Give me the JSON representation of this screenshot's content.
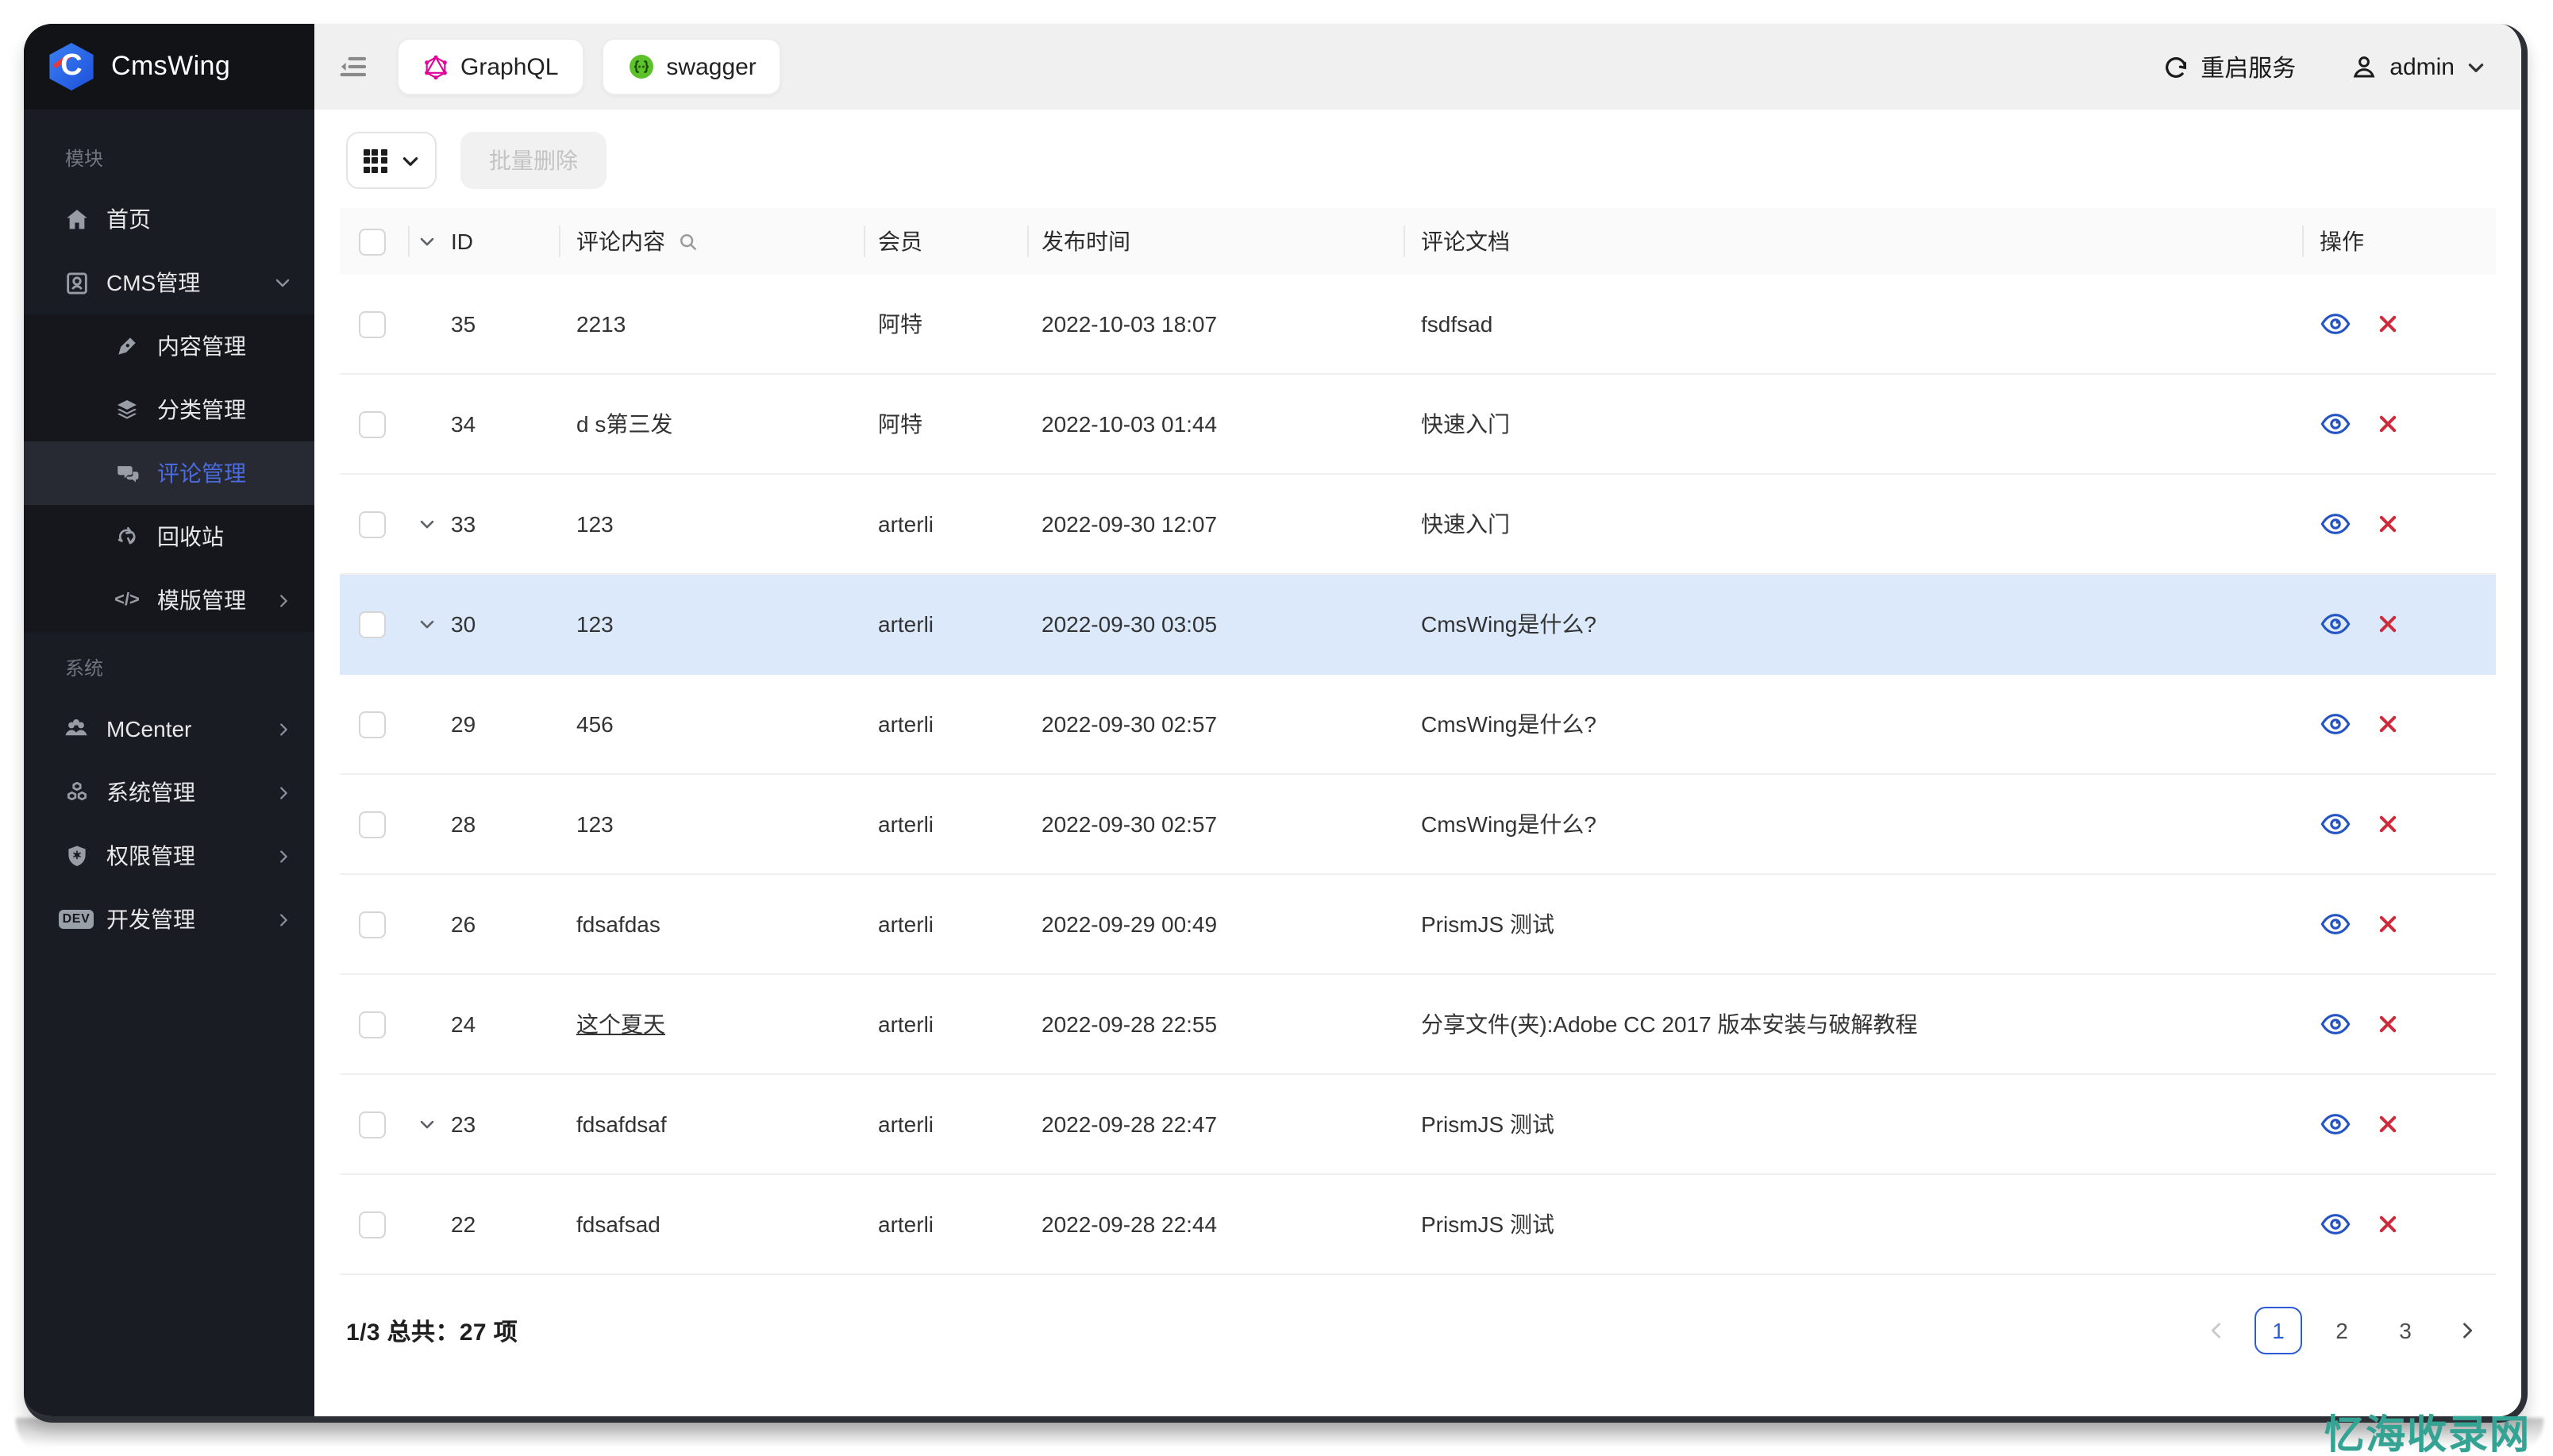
{
  "app": {
    "title": "CmsWing"
  },
  "sidebar": {
    "logo_text": "CmsWing",
    "dev_badge": "DEV",
    "sections": [
      {
        "label": "模块",
        "items": [
          {
            "label": "首页",
            "icon": "home-icon"
          },
          {
            "label": "CMS管理",
            "icon": "cms-book-icon",
            "chevron": "down"
          }
        ],
        "children": [
          {
            "label": "内容管理",
            "icon": "pen-icon"
          },
          {
            "label": "分类管理",
            "icon": "layers-icon"
          },
          {
            "label": "评论管理",
            "icon": "comments-icon",
            "active": true
          },
          {
            "label": "回收站",
            "icon": "recycle-icon"
          },
          {
            "label": "模版管理",
            "icon": "code-icon",
            "chevron": "right"
          }
        ]
      },
      {
        "label": "系统",
        "items": [
          {
            "label": "MCenter",
            "icon": "users-icon",
            "chevron": "right"
          },
          {
            "label": "系统管理",
            "icon": "cubes-icon",
            "chevron": "right"
          },
          {
            "label": "权限管理",
            "icon": "shield-icon",
            "chevron": "right"
          },
          {
            "label": "开发管理",
            "icon": "dev-icon",
            "chevron": "right"
          }
        ]
      }
    ]
  },
  "topbar": {
    "graphql_label": "GraphQL",
    "swagger_label": "swagger",
    "restart_label": "重启服务",
    "user_label": "admin"
  },
  "toolbar": {
    "batch_delete_label": "批量删除"
  },
  "table": {
    "headers": {
      "id": "ID",
      "content": "评论内容",
      "member": "会员",
      "time": "发布时间",
      "doc": "评论文档",
      "actions": "操作"
    },
    "rows": [
      {
        "id": "35",
        "content": "2213",
        "member": "阿特",
        "time": "2022-10-03 18:07",
        "doc": "fsdfsad",
        "expander": false,
        "highlight": false,
        "link": false
      },
      {
        "id": "34",
        "content": "d s第三发",
        "member": "阿特",
        "time": "2022-10-03 01:44",
        "doc": "快速入门",
        "expander": false,
        "highlight": false,
        "link": false
      },
      {
        "id": "33",
        "content": "123",
        "member": "arterli",
        "time": "2022-09-30 12:07",
        "doc": "快速入门",
        "expander": true,
        "highlight": false,
        "link": false
      },
      {
        "id": "30",
        "content": "123",
        "member": "arterli",
        "time": "2022-09-30 03:05",
        "doc": "CmsWing是什么?",
        "expander": true,
        "highlight": true,
        "link": false
      },
      {
        "id": "29",
        "content": "456",
        "member": "arterli",
        "time": "2022-09-30 02:57",
        "doc": "CmsWing是什么?",
        "expander": false,
        "highlight": false,
        "link": false
      },
      {
        "id": "28",
        "content": "123",
        "member": "arterli",
        "time": "2022-09-30 02:57",
        "doc": "CmsWing是什么?",
        "expander": false,
        "highlight": false,
        "link": false
      },
      {
        "id": "26",
        "content": "fdsafdas",
        "member": "arterli",
        "time": "2022-09-29 00:49",
        "doc": "PrismJS 测试",
        "expander": false,
        "highlight": false,
        "link": false
      },
      {
        "id": "24",
        "content": "这个夏天",
        "member": "arterli",
        "time": "2022-09-28 22:55",
        "doc": "分享文件(夹):Adobe CC 2017 版本安装与破解教程",
        "expander": false,
        "highlight": false,
        "link": true
      },
      {
        "id": "23",
        "content": "fdsafdsaf",
        "member": "arterli",
        "time": "2022-09-28 22:47",
        "doc": "PrismJS 测试",
        "expander": true,
        "highlight": false,
        "link": false
      },
      {
        "id": "22",
        "content": "fdsafsad",
        "member": "arterli",
        "time": "2022-09-28 22:44",
        "doc": "PrismJS 测试",
        "expander": false,
        "highlight": false,
        "link": false
      }
    ]
  },
  "pagination": {
    "summary": "1/3 总共：27 项",
    "pages": [
      "1",
      "2",
      "3"
    ],
    "active_page": "1"
  },
  "watermark": "忆海收录网",
  "colors": {
    "accent_blue": "#2b5bd7",
    "danger_red": "#ce2b3c",
    "highlight_row": "#dbe9fb",
    "graphql_pink": "#e10098",
    "swagger_green": "#5dc229",
    "sidebar_bg": "#1a1c23",
    "watermark_teal": "#35a394"
  }
}
